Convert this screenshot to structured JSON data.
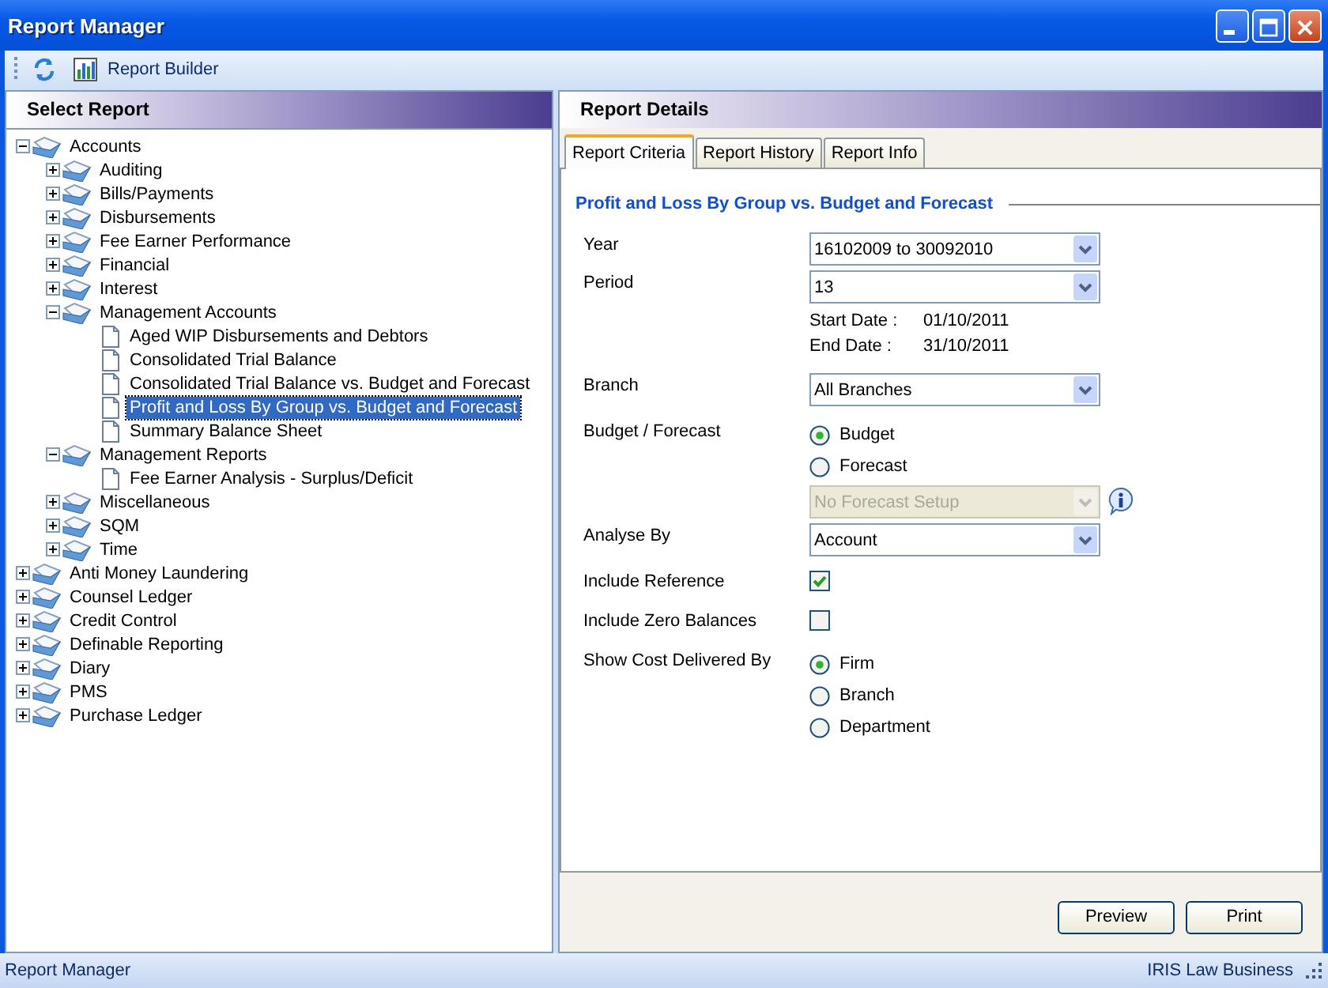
{
  "window": {
    "title": "Report Manager"
  },
  "toolbar": {
    "items": [
      {
        "kind": "refresh"
      },
      {
        "kind": "builder",
        "label": "Report Builder"
      }
    ]
  },
  "left_panel": {
    "title": "Select Report",
    "tree": [
      {
        "label": "Accounts",
        "kind": "folder",
        "expanded": true,
        "selected": false,
        "children": [
          {
            "label": "Auditing",
            "kind": "folder",
            "expanded": false,
            "selected": false
          },
          {
            "label": "Bills/Payments",
            "kind": "folder",
            "expanded": false,
            "selected": false
          },
          {
            "label": "Disbursements",
            "kind": "folder",
            "expanded": false,
            "selected": false
          },
          {
            "label": "Fee Earner Performance",
            "kind": "folder",
            "expanded": false,
            "selected": false
          },
          {
            "label": "Financial",
            "kind": "folder",
            "expanded": false,
            "selected": false
          },
          {
            "label": "Interest",
            "kind": "folder",
            "expanded": false,
            "selected": false
          },
          {
            "label": "Management Accounts",
            "kind": "folder",
            "expanded": true,
            "selected": false,
            "children": [
              {
                "label": "Aged WIP Disbursements and Debtors",
                "kind": "report",
                "selected": false
              },
              {
                "label": "Consolidated Trial Balance",
                "kind": "report",
                "selected": false
              },
              {
                "label": "Consolidated Trial Balance vs. Budget and Forecast",
                "kind": "report",
                "selected": false
              },
              {
                "label": "Profit and Loss By Group vs. Budget and Forecast",
                "kind": "report",
                "selected": true
              },
              {
                "label": "Summary Balance Sheet",
                "kind": "report",
                "selected": false
              }
            ]
          },
          {
            "label": "Management Reports",
            "kind": "folder",
            "expanded": true,
            "selected": false,
            "children": [
              {
                "label": "Fee Earner Analysis - Surplus/Deficit",
                "kind": "report",
                "selected": false
              }
            ]
          },
          {
            "label": "Miscellaneous",
            "kind": "folder",
            "expanded": false,
            "selected": false
          },
          {
            "label": "SQM",
            "kind": "folder",
            "expanded": false,
            "selected": false
          },
          {
            "label": "Time",
            "kind": "folder",
            "expanded": false,
            "selected": false
          }
        ]
      },
      {
        "label": "Anti Money Laundering",
        "kind": "folder",
        "expanded": false,
        "selected": false
      },
      {
        "label": "Counsel Ledger",
        "kind": "folder",
        "expanded": false,
        "selected": false
      },
      {
        "label": "Credit Control",
        "kind": "folder",
        "expanded": false,
        "selected": false
      },
      {
        "label": "Definable Reporting",
        "kind": "folder",
        "expanded": false,
        "selected": false
      },
      {
        "label": "Diary",
        "kind": "folder",
        "expanded": false,
        "selected": false
      },
      {
        "label": "PMS",
        "kind": "folder",
        "expanded": false,
        "selected": false
      },
      {
        "label": "Purchase Ledger",
        "kind": "folder",
        "expanded": false,
        "selected": false
      }
    ]
  },
  "right_panel": {
    "title": "Report Details",
    "tabs": [
      {
        "label": "Report Criteria",
        "selected": true
      },
      {
        "label": "Report History",
        "selected": false
      },
      {
        "label": "Report Info",
        "selected": false
      }
    ],
    "group_title": "Profit and Loss By Group vs. Budget and Forecast",
    "rows": [
      {
        "kind": "combo",
        "label": "Year",
        "value": "16102009 to 30092010",
        "disabled": false,
        "info": false
      },
      {
        "kind": "combo",
        "label": "Period",
        "value": "13",
        "disabled": false,
        "info": false
      },
      {
        "kind": "dates",
        "items": [
          {
            "label": "Start Date  :",
            "value": "01/10/2011"
          },
          {
            "label": "End Date :",
            "value": "31/10/2011"
          }
        ]
      },
      {
        "kind": "combo",
        "label": "Branch",
        "value": "All Branches",
        "disabled": false,
        "info": false
      },
      {
        "kind": "radios",
        "label": "Budget / Forecast",
        "options": [
          {
            "label": "Budget",
            "selected": true
          },
          {
            "label": "Forecast",
            "selected": false
          }
        ]
      },
      {
        "kind": "combo",
        "value": "No Forecast Setup",
        "disabled": true,
        "info": true
      },
      {
        "kind": "combo",
        "label": "Analyse By",
        "value": "Account",
        "disabled": false,
        "info": false
      },
      {
        "kind": "checkbox",
        "label": "Include Reference",
        "checked": true
      },
      {
        "kind": "checkbox",
        "label": "Include Zero Balances",
        "checked": false
      },
      {
        "kind": "radios",
        "label": "Show Cost Delivered By",
        "options": [
          {
            "label": "Firm",
            "selected": true
          },
          {
            "label": "Branch",
            "selected": false
          },
          {
            "label": "Department",
            "selected": false
          }
        ]
      }
    ],
    "buttons": [
      "Preview",
      "Print"
    ]
  },
  "status_bar": {
    "left": "Report Manager",
    "right": "IRIS Law Business"
  }
}
